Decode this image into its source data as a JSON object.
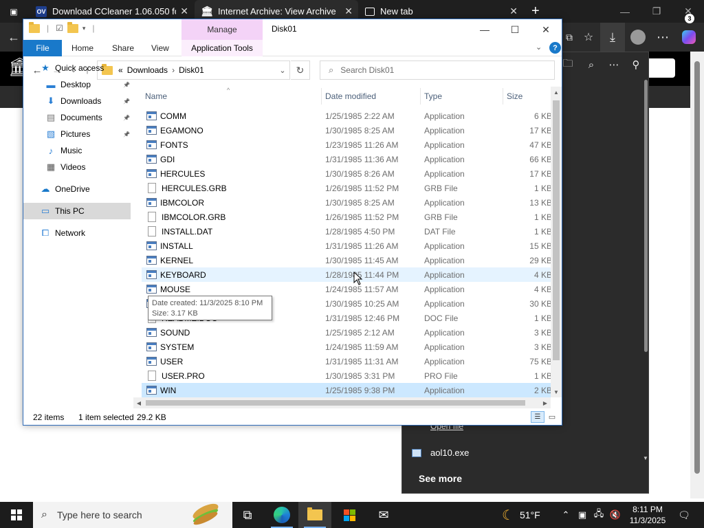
{
  "browser": {
    "tabs": [
      {
        "label": "Download CCleaner 1.06.050 for W",
        "favicon": "OV"
      },
      {
        "label": "Internet Archive: View Archive",
        "favicon": "ia-icon"
      },
      {
        "label": "New tab",
        "favicon": "newtab-icon"
      }
    ],
    "new_tab_symbol": "+",
    "download_panel": {
      "open_file_link": "Open file",
      "item_name": "aol10.exe",
      "see_more": "See more"
    }
  },
  "explorer": {
    "title": "Disk01",
    "manage_label": "Manage",
    "ribbon": {
      "file": "File",
      "home": "Home",
      "share": "Share",
      "view": "View",
      "app_tools": "Application Tools",
      "help": "?"
    },
    "address": {
      "overflow": "«",
      "crumbs": [
        "Downloads",
        "Disk01"
      ],
      "separator": "›"
    },
    "search_placeholder": "Search Disk01",
    "nav": [
      {
        "label": "Quick access",
        "icon": "star-icon",
        "color": "#1979ca"
      },
      {
        "label": "Desktop",
        "icon": "desktop-icon",
        "color": "#2a7fd4",
        "pinned": true
      },
      {
        "label": "Downloads",
        "icon": "download-icon",
        "color": "#2a7fd4",
        "pinned": true
      },
      {
        "label": "Documents",
        "icon": "documents-icon",
        "color": "#777777",
        "pinned": true
      },
      {
        "label": "Pictures",
        "icon": "pictures-icon",
        "color": "#2a7fd4",
        "pinned": true
      },
      {
        "label": "Music",
        "icon": "music-icon",
        "color": "#2a7fd4"
      },
      {
        "label": "Videos",
        "icon": "videos-icon",
        "color": "#555555"
      },
      {
        "label": "OneDrive",
        "icon": "cloud-icon",
        "color": "#1979ca"
      },
      {
        "label": "This PC",
        "icon": "computer-icon",
        "color": "#2a7fd4",
        "selected": true
      },
      {
        "label": "Network",
        "icon": "network-icon",
        "color": "#2a7fd4"
      }
    ],
    "columns": [
      "Name",
      "Date modified",
      "Type",
      "Size"
    ],
    "files": [
      {
        "name": "COMM",
        "date": "1/25/1985 2:22 AM",
        "type": "Application",
        "size": "6 KB",
        "icon": "app"
      },
      {
        "name": "EGAMONO",
        "date": "1/30/1985 8:25 AM",
        "type": "Application",
        "size": "17 KB",
        "icon": "app"
      },
      {
        "name": "FONTS",
        "date": "1/23/1985 11:26 AM",
        "type": "Application",
        "size": "47 KB",
        "icon": "app"
      },
      {
        "name": "GDI",
        "date": "1/31/1985 11:36 AM",
        "type": "Application",
        "size": "66 KB",
        "icon": "app"
      },
      {
        "name": "HERCULES",
        "date": "1/30/1985 8:26 AM",
        "type": "Application",
        "size": "17 KB",
        "icon": "app"
      },
      {
        "name": "HERCULES.GRB",
        "date": "1/26/1985 11:52 PM",
        "type": "GRB File",
        "size": "1 KB",
        "icon": "doc"
      },
      {
        "name": "IBMCOLOR",
        "date": "1/30/1985 8:25 AM",
        "type": "Application",
        "size": "13 KB",
        "icon": "app"
      },
      {
        "name": "IBMCOLOR.GRB",
        "date": "1/26/1985 11:52 PM",
        "type": "GRB File",
        "size": "1 KB",
        "icon": "doc"
      },
      {
        "name": "INSTALL.DAT",
        "date": "1/28/1985 4:50 PM",
        "type": "DAT File",
        "size": "1 KB",
        "icon": "doc"
      },
      {
        "name": "INSTALL",
        "date": "1/31/1985 11:26 AM",
        "type": "Application",
        "size": "15 KB",
        "icon": "app"
      },
      {
        "name": "KERNEL",
        "date": "1/30/1985 11:45 AM",
        "type": "Application",
        "size": "29 KB",
        "icon": "app"
      },
      {
        "name": "KEYBOARD",
        "date": "1/28/1985 11:44 PM",
        "type": "Application",
        "size": "4 KB",
        "icon": "app",
        "state": "hover"
      },
      {
        "name": "MOUSE",
        "date": "1/24/1985 11:57 AM",
        "type": "Application",
        "size": "4 KB",
        "icon": "app"
      },
      {
        "name": "",
        "date": "1/30/1985 10:25 AM",
        "type": "Application",
        "size": "30 KB",
        "icon": "app"
      },
      {
        "name": "README.DOC",
        "date": "1/31/1985 12:46 PM",
        "type": "DOC File",
        "size": "1 KB",
        "icon": "doc"
      },
      {
        "name": "SOUND",
        "date": "1/25/1985 2:12 AM",
        "type": "Application",
        "size": "3 KB",
        "icon": "app"
      },
      {
        "name": "SYSTEM",
        "date": "1/24/1985 11:59 AM",
        "type": "Application",
        "size": "3 KB",
        "icon": "app"
      },
      {
        "name": "USER",
        "date": "1/31/1985 11:31 AM",
        "type": "Application",
        "size": "75 KB",
        "icon": "app"
      },
      {
        "name": "USER.PRO",
        "date": "1/30/1985 3:31 PM",
        "type": "PRO File",
        "size": "1 KB",
        "icon": "doc"
      },
      {
        "name": "WIN",
        "date": "1/25/1985 9:38 PM",
        "type": "Application",
        "size": "2 KB",
        "icon": "app",
        "state": "selected"
      }
    ],
    "tooltip": {
      "line1": "Date created: 11/3/2025 8:10 PM",
      "line2": "Size: 3.17 KB"
    },
    "status": {
      "items": "22 items",
      "selected": "1 item selected",
      "size": "29.2 KB"
    }
  },
  "taskbar": {
    "search_placeholder": "Type here to search",
    "weather_temp": "51°F",
    "time": "8:11 PM",
    "date": "11/3/2025",
    "notification_count": "3"
  }
}
